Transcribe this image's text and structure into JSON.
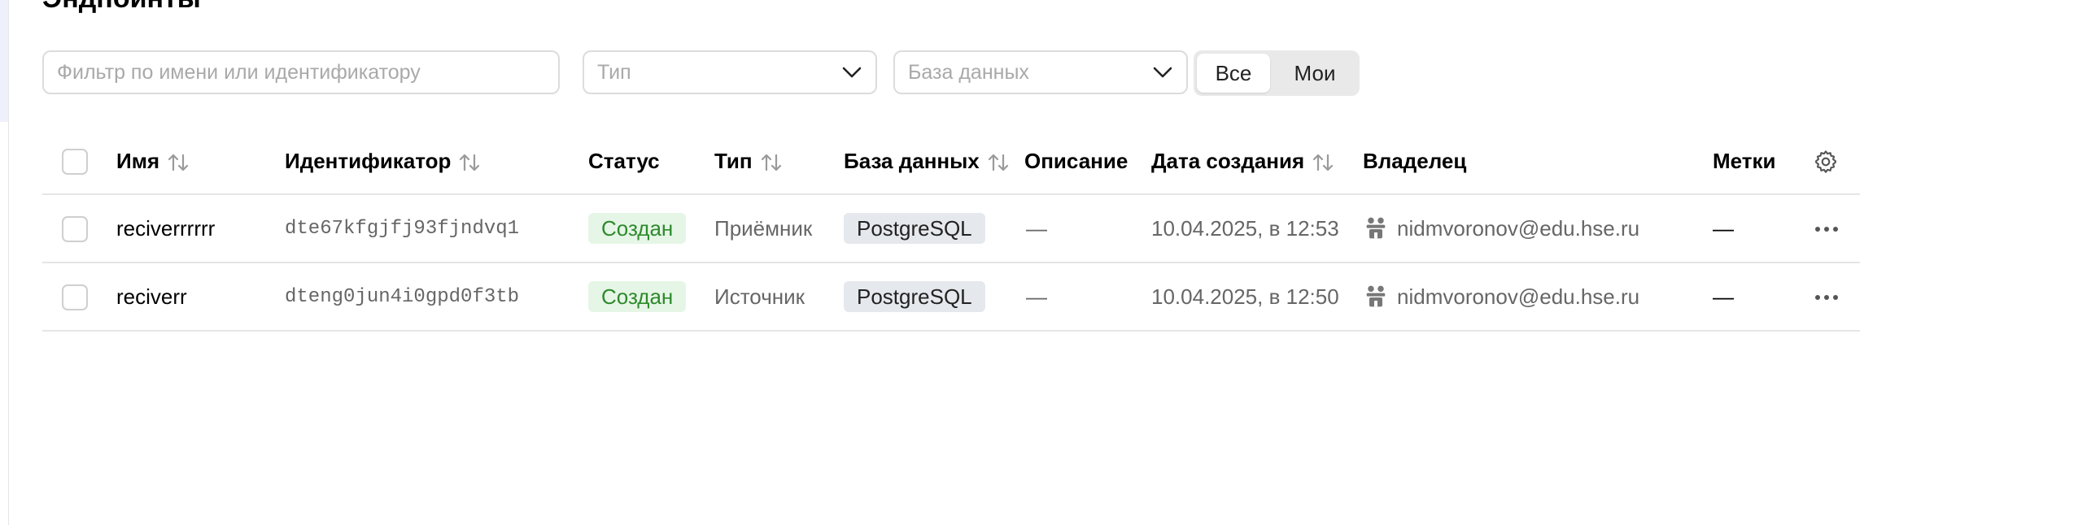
{
  "page": {
    "title": "Эндпоинты"
  },
  "filters": {
    "name_placeholder": "Фильтр по имени или идентификатору",
    "type_placeholder": "Тип",
    "database_placeholder": "База данных",
    "ownership": {
      "all_label": "Все",
      "mine_label": "Мои",
      "selected": "Все"
    }
  },
  "table": {
    "columns": {
      "name": "Имя",
      "id": "Идентификатор",
      "status": "Статус",
      "type": "Тип",
      "database": "База данных",
      "description": "Описание",
      "created": "Дата создания",
      "owner": "Владелец",
      "labels": "Метки"
    },
    "rows": [
      {
        "name": "reciverrrrrr",
        "id": "dte67kfgjfj93fjndvq1",
        "status": "Создан",
        "type": "Приёмник",
        "database": "PostgreSQL",
        "description": "—",
        "created": "10.04.2025, в 12:53",
        "owner": "nidmvoronov@edu.hse.ru",
        "labels": "—"
      },
      {
        "name": "reciverr",
        "id": "dteng0jun4i0gpd0f3tb",
        "status": "Создан",
        "type": "Источник",
        "database": "PostgreSQL",
        "description": "—",
        "created": "10.04.2025, в 12:50",
        "owner": "nidmvoronov@edu.hse.ru",
        "labels": "—"
      }
    ]
  },
  "colors": {
    "status_bg": "#e6f6e6",
    "status_text": "#2d8a2d",
    "db_badge_bg": "#e5e8ec",
    "border": "#dcdcdc"
  },
  "icons": {
    "sort": "sort-arrows-icon",
    "settings": "gear-icon",
    "owner": "user-group-icon",
    "row_actions": "more-horizontal-icon",
    "dropdown": "chevron-down-icon"
  }
}
